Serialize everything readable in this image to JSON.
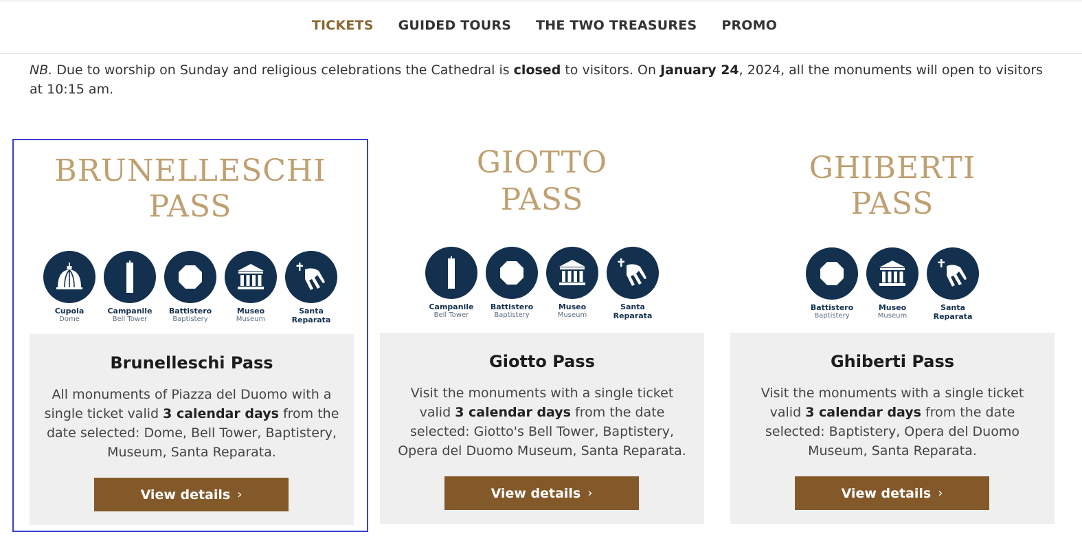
{
  "nav": {
    "items": [
      {
        "label": "TICKETS",
        "active": true
      },
      {
        "label": "GUIDED TOURS",
        "active": false
      },
      {
        "label": "THE TWO TREASURES",
        "active": false
      },
      {
        "label": "PROMO",
        "active": false
      }
    ]
  },
  "notice": {
    "nb": "NB.",
    "part1": " Due to worship on Sunday and religious celebrations the Cathedral is ",
    "closed": "closed",
    "part2": " to visitors. On ",
    "date": "January 24",
    "part3": ", 2024, all the monuments will open to visitors at 10:15 am."
  },
  "cards": [
    {
      "title_line1": "BRUNELLESCHI",
      "title_line2": "PASS",
      "icons": [
        {
          "icon": "dome-icon",
          "label": "Cupola",
          "sub": "Dome"
        },
        {
          "icon": "bell-tower-icon",
          "label": "Campanile",
          "sub": "Bell Tower"
        },
        {
          "icon": "baptistery-icon",
          "label": "Battistero",
          "sub": "Baptistery"
        },
        {
          "icon": "museum-icon",
          "label": "Museo",
          "sub": "Museum"
        },
        {
          "icon": "santa-reparata-icon",
          "label": "Santa",
          "sub": "Reparata"
        }
      ],
      "heading": "Brunelleschi Pass",
      "desc_a": "All monuments of Piazza del Duomo with a single ticket valid ",
      "desc_b": "3 calendar days",
      "desc_c": " from the date selected: Dome, Bell Tower, Baptistery, Museum, Santa Reparata.",
      "button": "View details",
      "chevron": "›"
    },
    {
      "title_line1": "GIOTTO",
      "title_line2": "PASS",
      "icons": [
        {
          "icon": "bell-tower-icon",
          "label": "Campanile",
          "sub": "Bell Tower"
        },
        {
          "icon": "baptistery-icon",
          "label": "Battistero",
          "sub": "Baptistery"
        },
        {
          "icon": "museum-icon",
          "label": "Museo",
          "sub": "Museum"
        },
        {
          "icon": "santa-reparata-icon",
          "label": "Santa",
          "sub": "Reparata"
        }
      ],
      "heading": "Giotto Pass",
      "desc_a": "Visit the monuments with a single ticket valid ",
      "desc_b": "3 calendar days",
      "desc_c": " from the date selected: Giotto's Bell Tower, Baptistery, Opera del Duomo Museum, Santa Reparata.",
      "button": "View details",
      "chevron": "›"
    },
    {
      "title_line1": "GHIBERTI",
      "title_line2": "PASS",
      "icons": [
        {
          "icon": "baptistery-icon",
          "label": "Battistero",
          "sub": "Baptistery"
        },
        {
          "icon": "museum-icon",
          "label": "Museo",
          "sub": "Museum"
        },
        {
          "icon": "santa-reparata-icon",
          "label": "Santa",
          "sub": "Reparata"
        }
      ],
      "heading": "Ghiberti Pass",
      "desc_a": "Visit the monuments with a single ticket valid ",
      "desc_b": "3 calendar days",
      "desc_c": " from the date selected: Baptistery, Opera del Duomo Museum, Santa Reparata.",
      "button": "View details",
      "chevron": "›"
    }
  ],
  "colors": {
    "accent": "#8a6633",
    "title_gold": "#bfa070",
    "icon_navy": "#13304f",
    "button_brown": "#84592a",
    "panel_gray": "#efefef",
    "focus_outline": "#3b3fd1"
  }
}
